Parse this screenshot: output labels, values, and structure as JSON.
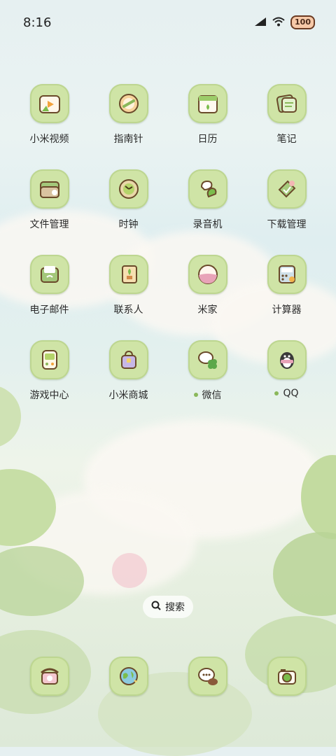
{
  "status": {
    "time": "8:16",
    "battery": "100"
  },
  "apps": [
    {
      "label": "小米视频",
      "icon": "video-icon"
    },
    {
      "label": "指南针",
      "icon": "compass-icon"
    },
    {
      "label": "日历",
      "icon": "calendar-icon"
    },
    {
      "label": "笔记",
      "icon": "notes-icon"
    },
    {
      "label": "文件管理",
      "icon": "folder-icon"
    },
    {
      "label": "时钟",
      "icon": "clock-icon"
    },
    {
      "label": "录音机",
      "icon": "recorder-icon"
    },
    {
      "label": "下载管理",
      "icon": "download-icon"
    },
    {
      "label": "电子邮件",
      "icon": "mail-icon"
    },
    {
      "label": "联系人",
      "icon": "contacts-icon"
    },
    {
      "label": "米家",
      "icon": "mijia-icon"
    },
    {
      "label": "计算器",
      "icon": "calculator-icon"
    },
    {
      "label": "游戏中心",
      "icon": "game-center-icon"
    },
    {
      "label": "小米商城",
      "icon": "shop-icon"
    },
    {
      "label": "微信",
      "icon": "wechat-icon",
      "new": true
    },
    {
      "label": "QQ",
      "icon": "qq-icon",
      "new": true
    }
  ],
  "search": {
    "label": "搜索"
  },
  "dock": [
    {
      "icon": "phone-icon"
    },
    {
      "icon": "browser-icon"
    },
    {
      "icon": "messages-icon"
    },
    {
      "icon": "camera-icon"
    }
  ],
  "colors": {
    "icon_bg": "#cfe4a6",
    "accent": "#8ab85a"
  }
}
